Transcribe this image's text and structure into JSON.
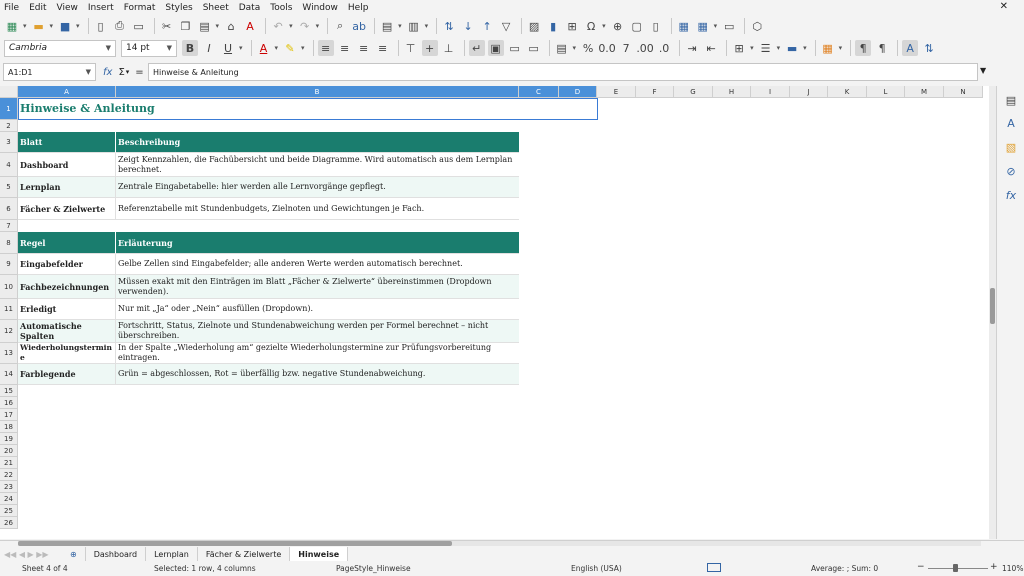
{
  "menu": [
    "File",
    "Edit",
    "View",
    "Insert",
    "Format",
    "Styles",
    "Sheet",
    "Data",
    "Tools",
    "Window",
    "Help"
  ],
  "close_glyph": "✕",
  "toolbar": {
    "font_name": "Cambria",
    "font_size": "14 pt"
  },
  "formula": {
    "cell_ref": "A1:D1",
    "fx": "fx",
    "sum": "Σ",
    "eq": "=",
    "content": "Hinweise & Anleitung"
  },
  "columns": [
    "A",
    "B",
    "C",
    "D",
    "E",
    "F",
    "G",
    "H",
    "I",
    "J",
    "K",
    "L",
    "M",
    "N"
  ],
  "rows": [
    "1",
    "2",
    "3",
    "4",
    "5",
    "6",
    "7",
    "8",
    "9",
    "10",
    "11",
    "12",
    "13",
    "14",
    "15",
    "16",
    "17",
    "18",
    "19",
    "20",
    "21",
    "22",
    "23",
    "24",
    "25",
    "26"
  ],
  "sheet": {
    "title": "Hinweise & Anleitung",
    "table1_header": [
      "Blatt",
      "Beschreibung"
    ],
    "table1": [
      [
        "Dashboard",
        "Zeigt Kennzahlen, die Fachübersicht und beide Diagramme. Wird automatisch aus dem Lernplan berechnet."
      ],
      [
        "Lernplan",
        "Zentrale Eingabetabelle: hier werden alle Lernvorgänge gepflegt."
      ],
      [
        "Fächer & Zielwerte",
        "Referenztabelle mit Stundenbudgets, Zielnoten und Gewichtungen je Fach."
      ]
    ],
    "table2_header": [
      "Regel",
      "Erläuterung"
    ],
    "table2": [
      [
        "Eingabefelder",
        "Gelbe Zellen sind Eingabefelder; alle anderen Werte werden automatisch berechnet."
      ],
      [
        "Fachbezeichnungen",
        "Müssen exakt mit den Einträgen im Blatt „Fächer & Zielwerte“ übereinstimmen (Dropdown verwenden)."
      ],
      [
        "Erledigt",
        "Nur mit „Ja“ oder „Nein“ ausfüllen (Dropdown)."
      ],
      [
        "Automatische Spalten",
        "Fortschritt, Status, Zielnote und Stundenabweichung werden per Formel berechnet – nicht überschreiben."
      ],
      [
        "Wiederholungstermine",
        "In der Spalte „Wiederholung am“ gezielte Wiederholungstermine zur Prüfungsvorbereitung eintragen."
      ],
      [
        "Farblegende",
        "Grün = abgeschlossen, Rot = überfällig bzw. negative Stundenabweichung."
      ]
    ]
  },
  "tabs": [
    "Dashboard",
    "Lernplan",
    "Fächer & Zielwerte",
    "Hinweise"
  ],
  "tab_add": "⊕",
  "status": {
    "sheet": "Sheet 4 of 4",
    "selection": "Selected: 1 row, 4 columns",
    "page_style": "PageStyle_Hinweise",
    "language": "English (USA)",
    "summary": "Average: ; Sum: 0",
    "zoom": "110%"
  },
  "colors": {
    "header_fill": "#1a7d6e",
    "title_color": "#1a7d6e",
    "alt_row": "#eef8f5",
    "selection": "#4a90d9"
  }
}
